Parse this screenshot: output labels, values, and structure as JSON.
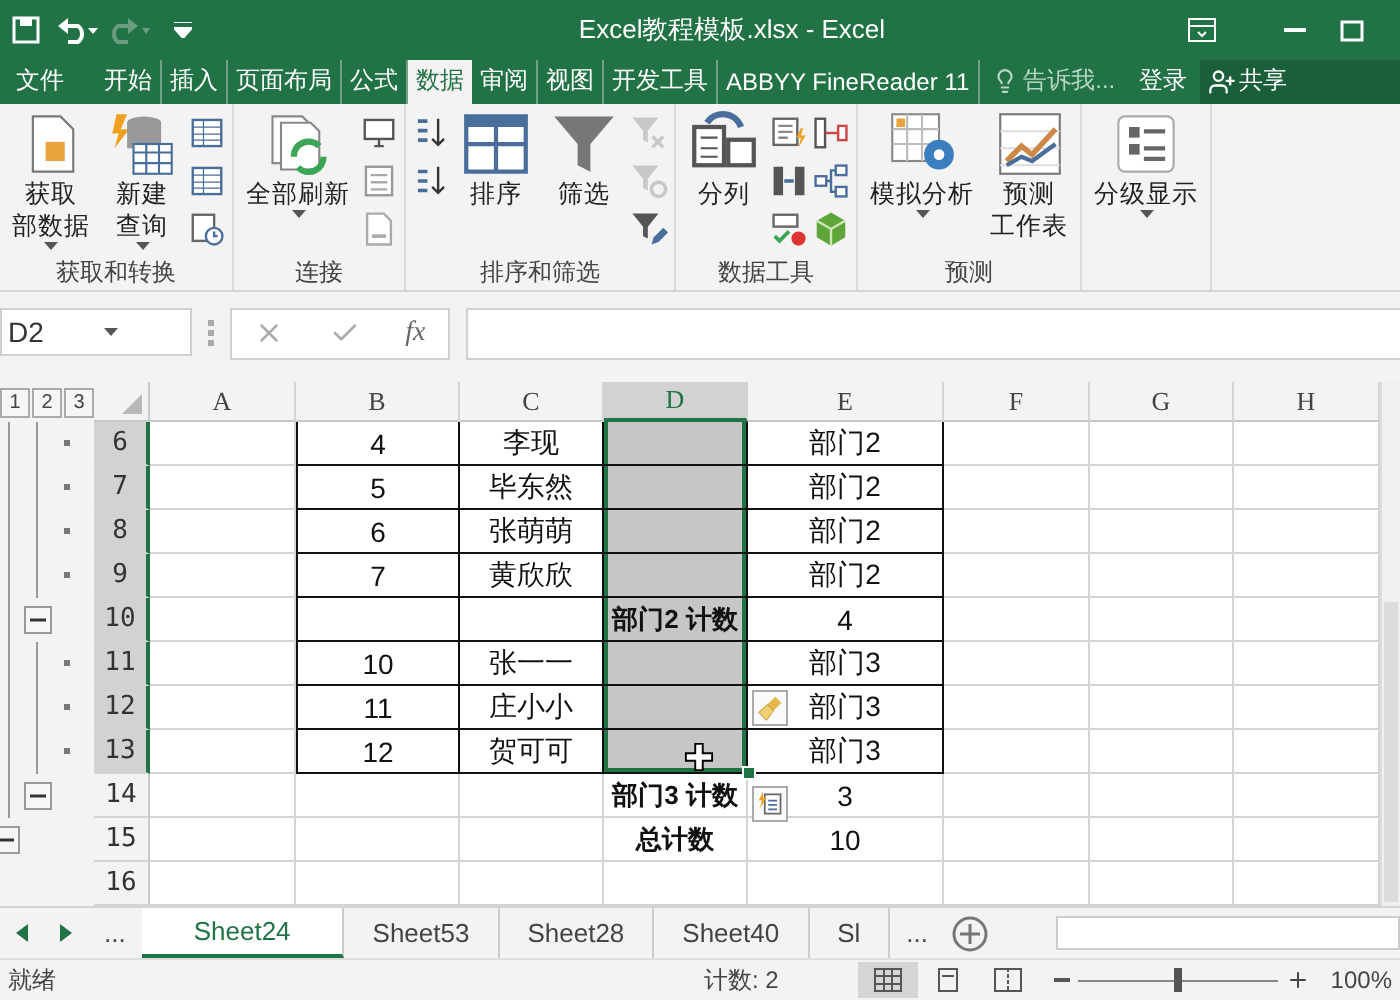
{
  "title_bar": {
    "title": "Excel教程模板.xlsx - Excel"
  },
  "menu_tabs": [
    {
      "label": "文件",
      "selected": false
    },
    {
      "label": "开始",
      "selected": false
    },
    {
      "label": "插入",
      "selected": false
    },
    {
      "label": "页面布局",
      "selected": false
    },
    {
      "label": "公式",
      "selected": false
    },
    {
      "label": "数据",
      "selected": true
    },
    {
      "label": "审阅",
      "selected": false
    },
    {
      "label": "视图",
      "selected": false
    },
    {
      "label": "开发工具",
      "selected": false
    },
    {
      "label": "ABBYY FineReader 11",
      "selected": false
    }
  ],
  "tell_me": "告诉我...",
  "sign_in": "登录",
  "share": "共享",
  "ribbon_groups": [
    {
      "label": "获取和转换",
      "buttons": [
        {
          "lines": [
            "获取",
            "部数据"
          ],
          "dropdown": true
        },
        {
          "lines": [
            "新建",
            "查询"
          ],
          "dropdown": true
        }
      ]
    },
    {
      "label": "连接",
      "buttons": [
        {
          "lines": [
            "全部刷新"
          ],
          "dropdown": true
        }
      ]
    },
    {
      "label": "排序和筛选",
      "buttons": [
        {
          "lines": [
            "排序"
          ],
          "dropdown": false
        },
        {
          "lines": [
            "筛选"
          ],
          "dropdown": false
        }
      ]
    },
    {
      "label": "数据工具",
      "buttons": [
        {
          "lines": [
            "分列"
          ],
          "dropdown": false
        }
      ]
    },
    {
      "label": "预测",
      "buttons": [
        {
          "lines": [
            "模拟分析"
          ],
          "dropdown": true
        },
        {
          "lines": [
            "预测",
            "工作表"
          ],
          "dropdown": false
        }
      ]
    },
    {
      "buttons": [
        {
          "lines": [
            "分级显示"
          ],
          "dropdown": true
        }
      ]
    }
  ],
  "formula_bar": {
    "name_box": "D2",
    "function_button": "fx"
  },
  "outline_levels": [
    "1",
    "2",
    "3"
  ],
  "columns": [
    {
      "label": "A",
      "selected": false
    },
    {
      "label": "B",
      "selected": false
    },
    {
      "label": "C",
      "selected": false
    },
    {
      "label": "D",
      "selected": true
    },
    {
      "label": "E",
      "selected": false
    },
    {
      "label": "F",
      "selected": false
    },
    {
      "label": "G",
      "selected": false
    },
    {
      "label": "H",
      "selected": false
    }
  ],
  "rows": [
    {
      "number": "6",
      "selected": true,
      "kind": "detail",
      "bordered": true,
      "b": "4",
      "c": "李现",
      "e": "部门2"
    },
    {
      "number": "7",
      "selected": true,
      "kind": "detail",
      "bordered": true,
      "b": "5",
      "c": "毕东然",
      "e": "部门2"
    },
    {
      "number": "8",
      "selected": true,
      "kind": "detail",
      "bordered": true,
      "b": "6",
      "c": "张萌萌",
      "e": "部门2"
    },
    {
      "number": "9",
      "selected": true,
      "kind": "detail",
      "bordered": true,
      "b": "7",
      "c": "黄欣欣",
      "e": "部门2"
    },
    {
      "number": "10",
      "selected": true,
      "kind": "group-total",
      "bordered": true,
      "d": "部门2 计数",
      "e": "4"
    },
    {
      "number": "11",
      "selected": true,
      "kind": "detail",
      "bordered": true,
      "b": "10",
      "c": "张一一",
      "e": "部门3"
    },
    {
      "number": "12",
      "selected": true,
      "kind": "detail",
      "bordered": true,
      "b": "11",
      "c": "庄小小",
      "e": "部门3",
      "paste_options": true
    },
    {
      "number": "13",
      "selected": true,
      "kind": "detail",
      "bordered": true,
      "b": "12",
      "c": "贺可可",
      "e": "部门3",
      "cursor": true
    },
    {
      "number": "14",
      "selected": false,
      "kind": "group-total",
      "bordered": false,
      "d": "部门3 计数",
      "e": "3",
      "quick_analysis": true
    },
    {
      "number": "15",
      "selected": false,
      "kind": "grand-total",
      "bordered": false,
      "d": "总计数",
      "e": "10"
    },
    {
      "number": "16",
      "selected": false,
      "kind": "blank",
      "bordered": false
    }
  ],
  "sheet_tabs": {
    "more_left": "...",
    "more_right": "...",
    "tabs": [
      {
        "label": "Sheet24",
        "selected": true
      },
      {
        "label": "Sheet53",
        "selected": false
      },
      {
        "label": "Sheet28",
        "selected": false
      },
      {
        "label": "Sheet40",
        "selected": false
      },
      {
        "label": "Sl",
        "selected": false
      }
    ]
  },
  "status_bar": {
    "status": "就绪",
    "summary": "计数: 2",
    "views": [
      {
        "selected": true
      },
      {
        "selected": false
      },
      {
        "selected": false
      }
    ],
    "zoom": {
      "level": 0.5,
      "reading": "100%"
    }
  }
}
